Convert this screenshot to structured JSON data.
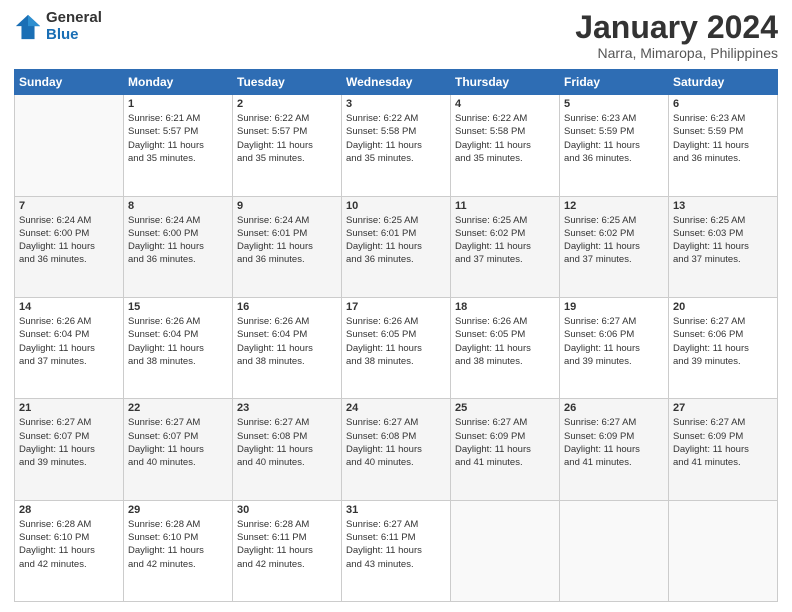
{
  "logo": {
    "general": "General",
    "blue": "Blue"
  },
  "title": "January 2024",
  "subtitle": "Narra, Mimaropa, Philippines",
  "headers": [
    "Sunday",
    "Monday",
    "Tuesday",
    "Wednesday",
    "Thursday",
    "Friday",
    "Saturday"
  ],
  "weeks": [
    [
      {
        "day": "",
        "info": ""
      },
      {
        "day": "1",
        "info": "Sunrise: 6:21 AM\nSunset: 5:57 PM\nDaylight: 11 hours\nand 35 minutes."
      },
      {
        "day": "2",
        "info": "Sunrise: 6:22 AM\nSunset: 5:57 PM\nDaylight: 11 hours\nand 35 minutes."
      },
      {
        "day": "3",
        "info": "Sunrise: 6:22 AM\nSunset: 5:58 PM\nDaylight: 11 hours\nand 35 minutes."
      },
      {
        "day": "4",
        "info": "Sunrise: 6:22 AM\nSunset: 5:58 PM\nDaylight: 11 hours\nand 35 minutes."
      },
      {
        "day": "5",
        "info": "Sunrise: 6:23 AM\nSunset: 5:59 PM\nDaylight: 11 hours\nand 36 minutes."
      },
      {
        "day": "6",
        "info": "Sunrise: 6:23 AM\nSunset: 5:59 PM\nDaylight: 11 hours\nand 36 minutes."
      }
    ],
    [
      {
        "day": "7",
        "info": "Sunrise: 6:24 AM\nSunset: 6:00 PM\nDaylight: 11 hours\nand 36 minutes."
      },
      {
        "day": "8",
        "info": "Sunrise: 6:24 AM\nSunset: 6:00 PM\nDaylight: 11 hours\nand 36 minutes."
      },
      {
        "day": "9",
        "info": "Sunrise: 6:24 AM\nSunset: 6:01 PM\nDaylight: 11 hours\nand 36 minutes."
      },
      {
        "day": "10",
        "info": "Sunrise: 6:25 AM\nSunset: 6:01 PM\nDaylight: 11 hours\nand 36 minutes."
      },
      {
        "day": "11",
        "info": "Sunrise: 6:25 AM\nSunset: 6:02 PM\nDaylight: 11 hours\nand 37 minutes."
      },
      {
        "day": "12",
        "info": "Sunrise: 6:25 AM\nSunset: 6:02 PM\nDaylight: 11 hours\nand 37 minutes."
      },
      {
        "day": "13",
        "info": "Sunrise: 6:25 AM\nSunset: 6:03 PM\nDaylight: 11 hours\nand 37 minutes."
      }
    ],
    [
      {
        "day": "14",
        "info": "Sunrise: 6:26 AM\nSunset: 6:04 PM\nDaylight: 11 hours\nand 37 minutes."
      },
      {
        "day": "15",
        "info": "Sunrise: 6:26 AM\nSunset: 6:04 PM\nDaylight: 11 hours\nand 38 minutes."
      },
      {
        "day": "16",
        "info": "Sunrise: 6:26 AM\nSunset: 6:04 PM\nDaylight: 11 hours\nand 38 minutes."
      },
      {
        "day": "17",
        "info": "Sunrise: 6:26 AM\nSunset: 6:05 PM\nDaylight: 11 hours\nand 38 minutes."
      },
      {
        "day": "18",
        "info": "Sunrise: 6:26 AM\nSunset: 6:05 PM\nDaylight: 11 hours\nand 38 minutes."
      },
      {
        "day": "19",
        "info": "Sunrise: 6:27 AM\nSunset: 6:06 PM\nDaylight: 11 hours\nand 39 minutes."
      },
      {
        "day": "20",
        "info": "Sunrise: 6:27 AM\nSunset: 6:06 PM\nDaylight: 11 hours\nand 39 minutes."
      }
    ],
    [
      {
        "day": "21",
        "info": "Sunrise: 6:27 AM\nSunset: 6:07 PM\nDaylight: 11 hours\nand 39 minutes."
      },
      {
        "day": "22",
        "info": "Sunrise: 6:27 AM\nSunset: 6:07 PM\nDaylight: 11 hours\nand 40 minutes."
      },
      {
        "day": "23",
        "info": "Sunrise: 6:27 AM\nSunset: 6:08 PM\nDaylight: 11 hours\nand 40 minutes."
      },
      {
        "day": "24",
        "info": "Sunrise: 6:27 AM\nSunset: 6:08 PM\nDaylight: 11 hours\nand 40 minutes."
      },
      {
        "day": "25",
        "info": "Sunrise: 6:27 AM\nSunset: 6:09 PM\nDaylight: 11 hours\nand 41 minutes."
      },
      {
        "day": "26",
        "info": "Sunrise: 6:27 AM\nSunset: 6:09 PM\nDaylight: 11 hours\nand 41 minutes."
      },
      {
        "day": "27",
        "info": "Sunrise: 6:27 AM\nSunset: 6:09 PM\nDaylight: 11 hours\nand 41 minutes."
      }
    ],
    [
      {
        "day": "28",
        "info": "Sunrise: 6:28 AM\nSunset: 6:10 PM\nDaylight: 11 hours\nand 42 minutes."
      },
      {
        "day": "29",
        "info": "Sunrise: 6:28 AM\nSunset: 6:10 PM\nDaylight: 11 hours\nand 42 minutes."
      },
      {
        "day": "30",
        "info": "Sunrise: 6:28 AM\nSunset: 6:11 PM\nDaylight: 11 hours\nand 42 minutes."
      },
      {
        "day": "31",
        "info": "Sunrise: 6:27 AM\nSunset: 6:11 PM\nDaylight: 11 hours\nand 43 minutes."
      },
      {
        "day": "",
        "info": ""
      },
      {
        "day": "",
        "info": ""
      },
      {
        "day": "",
        "info": ""
      }
    ]
  ]
}
